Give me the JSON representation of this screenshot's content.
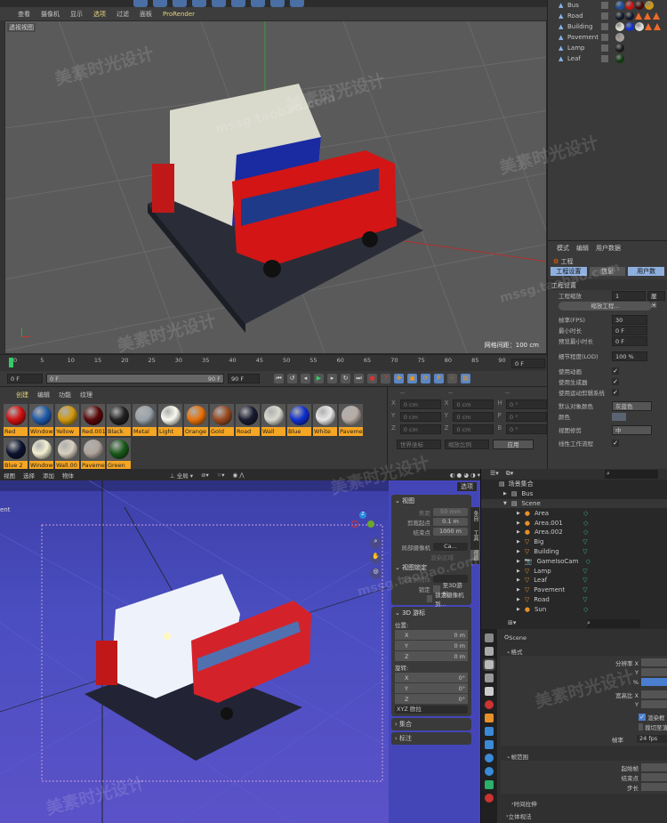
{
  "c4d": {
    "menu": [
      "查看",
      "摄像机",
      "显示",
      "选项",
      "过滤",
      "面板",
      "ProRender"
    ],
    "viewport_label": "透视视图",
    "grid_info": "网格间距：100 cm",
    "timeline_ticks": [
      "0",
      "5",
      "10",
      "15",
      "20",
      "25",
      "30",
      "35",
      "40",
      "45",
      "50",
      "55",
      "60",
      "65",
      "70",
      "75",
      "80",
      "85",
      "90"
    ],
    "timeline_current": "0 F",
    "controls": {
      "start": "0 F",
      "range_start": "0 F",
      "range_end": "90 F",
      "end": "90 F"
    },
    "material_menu": [
      "创建",
      "编辑",
      "功能",
      "纹理"
    ],
    "materials": [
      {
        "name": "Red",
        "color": "#d01010"
      },
      {
        "name": "Window",
        "color": "#1f5aa8"
      },
      {
        "name": "Yellow",
        "color": "#d09a10"
      },
      {
        "name": "Red.001",
        "color": "#5a0808"
      },
      {
        "name": "Black",
        "color": "#222222"
      },
      {
        "name": "Metal",
        "color": "#9aa3aa"
      },
      {
        "name": "Light",
        "color": "#fafaf0"
      },
      {
        "name": "Orange",
        "color": "#e8720a"
      },
      {
        "name": "Gold",
        "color": "#9a4a20"
      },
      {
        "name": "Road",
        "color": "#1a1c30"
      },
      {
        "name": "Wall",
        "color": "#d9d9cf"
      },
      {
        "name": "Blue",
        "color": "#1030d0"
      },
      {
        "name": "White",
        "color": "#e8e8e8"
      },
      {
        "name": "Paveme",
        "color": "#b8aca4"
      },
      {
        "name": "Blue 2",
        "color": "#0c1430"
      },
      {
        "name": "Window",
        "color": "#f4f0d0"
      },
      {
        "name": "Wall.00",
        "color": "#d8cfbf"
      },
      {
        "name": "Paveme",
        "color": "#b0a49c"
      },
      {
        "name": "Green",
        "color": "#1a5a1a"
      }
    ],
    "coords": {
      "header": [
        "--",
        "--",
        "--"
      ],
      "rows": [
        [
          "X",
          "0 cm",
          "X",
          "0 cm",
          "H",
          "0 °"
        ],
        [
          "Y",
          "0 cm",
          "Y",
          "0 cm",
          "P",
          "0 °"
        ],
        [
          "Z",
          "0 cm",
          "Z",
          "0 cm",
          "B",
          "0 °"
        ]
      ],
      "mode1": "世界坐标",
      "mode2": "缩放比例",
      "apply": "应用"
    },
    "objects": [
      {
        "name": "Bus",
        "tags": [
          "#1a4e9a",
          "#cc1111",
          "#4a0808",
          "#d09a10"
        ],
        "tris": 0
      },
      {
        "name": "Road",
        "tags": [
          "#141828",
          "#141828"
        ],
        "tris": 3
      },
      {
        "name": "Building",
        "tags": [
          "#ddddd0",
          "#1030d0",
          "#dddddd"
        ],
        "tris": 2
      },
      {
        "name": "Pavement",
        "tags": [
          "#aaa09a"
        ],
        "tris": 0
      },
      {
        "name": "Lamp",
        "tags": [
          "#1a1a1a"
        ],
        "tris": 0
      },
      {
        "name": "Leaf",
        "tags": [
          "#0e3a0e"
        ],
        "tris": 0
      }
    ],
    "attr": {
      "menu": [
        "模式",
        "编辑",
        "用户数据"
      ],
      "title": "工程",
      "tabs": [
        "工程设置",
        "信息",
        "用户数"
      ],
      "section": "工程设置",
      "scale_label": "工程缩放",
      "scale_value": "1",
      "scale_unit": "厘米",
      "scale_button": "缩放工程...",
      "fps_label": "帧率(FPS)",
      "fps": "30",
      "min_label": "最小时长",
      "min": "0 F",
      "pmin_label": "预览最小时长",
      "pmin": "0 F",
      "lod_label": "细节程度(LOD)",
      "lod": "100 %",
      "anim_label": "使用动画",
      "gen_label": "使用生成器",
      "deform_label": "使用运动剪辑系统",
      "color_label": "默认对象颜色",
      "color_value": "灰蓝色",
      "col_label": "颜色",
      "clip_label": "视图修剪",
      "clip_value": "中",
      "linear_label": "线性工作流程"
    }
  },
  "blender": {
    "header_menu": [
      "视图",
      "选择",
      "添加",
      "物体"
    ],
    "pivot": "全局",
    "left_text": "ent",
    "options": "选项",
    "view_panel": {
      "title": "视图",
      "focal_label": "焦距",
      "focal": "50 mm",
      "clip_start_label": "剪裁起点",
      "clip_start": "0.1 m",
      "clip_end_label": "结束点",
      "clip_end": "1000 m",
      "local_cam_label": "局部摄像机",
      "local_cam": "Ca...",
      "render_region": "渲染区域",
      "lock_title": "视图锁定",
      "lock_obj_label": "锁定到物体",
      "lock_label": "锁定",
      "lock_cursor": "至3D游标",
      "lock_camera": "锁定摄像机到..."
    },
    "cursor_panel": {
      "title": "3D 游标",
      "loc_label": "位置:",
      "loc": [
        [
          "X",
          "0 m"
        ],
        [
          "Y",
          "0 m"
        ],
        [
          "Z",
          "0 m"
        ]
      ],
      "rot_label": "旋转:",
      "rot": [
        [
          "X",
          "0°"
        ],
        [
          "Y",
          "0°"
        ],
        [
          "Z",
          "0°"
        ]
      ],
      "mode": "XYZ 欧拉"
    },
    "collections": "集合",
    "annotations": "标注",
    "side_tabs": [
      "条目",
      "工具",
      "视图"
    ],
    "outliner": {
      "root": "场景集合",
      "items": [
        {
          "name": "Bus",
          "indent": 0,
          "icon": "collection"
        },
        {
          "name": "Scene",
          "indent": 0,
          "icon": "collection"
        },
        {
          "name": "Area",
          "indent": 1,
          "icon": "light"
        },
        {
          "name": "Area.001",
          "indent": 1,
          "icon": "light"
        },
        {
          "name": "Area.002",
          "indent": 1,
          "icon": "light"
        },
        {
          "name": "Big",
          "indent": 1,
          "icon": "mesh"
        },
        {
          "name": "Building",
          "indent": 1,
          "icon": "mesh"
        },
        {
          "name": "GameIsoCam",
          "indent": 1,
          "icon": "camera"
        },
        {
          "name": "Lamp",
          "indent": 1,
          "icon": "mesh"
        },
        {
          "name": "Leaf",
          "indent": 1,
          "icon": "mesh"
        },
        {
          "name": "Pavement",
          "indent": 1,
          "icon": "mesh"
        },
        {
          "name": "Road",
          "indent": 1,
          "icon": "mesh"
        },
        {
          "name": "Sun",
          "indent": 1,
          "icon": "light"
        }
      ]
    },
    "props": {
      "scene": "Scene",
      "format": "格式",
      "res_x": "分辨率 X",
      "y": "Y",
      "pct": "%",
      "aspect_x": "宽高比 X",
      "aspect_y": "Y",
      "render_region": "渲染框",
      "crop": "裁切至渲",
      "fps_label": "帧率",
      "fps": "24 fps",
      "frame_range": "帧范围",
      "start": "起始帧",
      "end": "结束点",
      "step": "步长",
      "time_stretch": "时间拉伸",
      "stereo": "立体视法"
    }
  },
  "watermark": {
    "cn": "美素时光设计",
    "url": "mssg.taobao.com"
  }
}
